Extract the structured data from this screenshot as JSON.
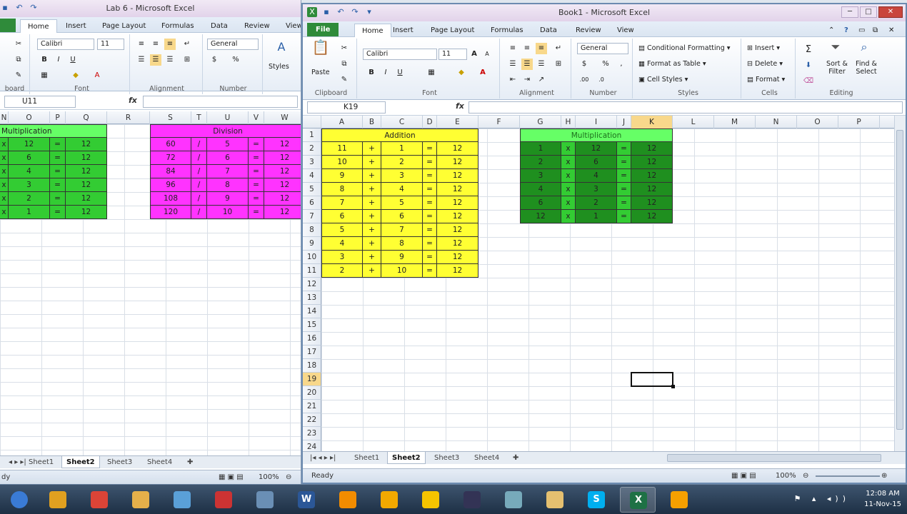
{
  "window_left": {
    "title": "Lab 6 - Microsoft Excel",
    "tabs": [
      "Home",
      "Insert",
      "Page Layout",
      "Formulas",
      "Data",
      "Review",
      "View"
    ],
    "name_box": "U11",
    "ribbon": {
      "font_name": "Calibri",
      "font_size": "11",
      "number_format": "General",
      "styles_label": "Styles",
      "groups": [
        "board",
        "Font",
        "Alignment",
        "Number"
      ]
    },
    "columns": [
      "N",
      "O",
      "P",
      "Q",
      "R",
      "S",
      "T",
      "U",
      "V",
      "W"
    ],
    "multiplication": {
      "title": "Multiplication",
      "rows": [
        [
          "x",
          "12",
          "=",
          "12"
        ],
        [
          "x",
          "6",
          "=",
          "12"
        ],
        [
          "x",
          "4",
          "=",
          "12"
        ],
        [
          "x",
          "3",
          "=",
          "12"
        ],
        [
          "x",
          "2",
          "=",
          "12"
        ],
        [
          "x",
          "1",
          "=",
          "12"
        ]
      ]
    },
    "division": {
      "title": "Division",
      "rows": [
        [
          "60",
          "/",
          "5",
          "=",
          "12"
        ],
        [
          "72",
          "/",
          "6",
          "=",
          "12"
        ],
        [
          "84",
          "/",
          "7",
          "=",
          "12"
        ],
        [
          "96",
          "/",
          "8",
          "=",
          "12"
        ],
        [
          "108",
          "/",
          "9",
          "=",
          "12"
        ],
        [
          "120",
          "/",
          "10",
          "=",
          "12"
        ]
      ]
    },
    "sheet_tabs": [
      "Sheet1",
      "Sheet2",
      "Sheet3",
      "Sheet4"
    ],
    "active_sheet": "Sheet2",
    "status": "dy",
    "zoom": "100%"
  },
  "window_right": {
    "title": "Book1 - Microsoft Excel",
    "file_tab": "File",
    "tabs": [
      "Home",
      "Insert",
      "Page Layout",
      "Formulas",
      "Data",
      "Review",
      "View"
    ],
    "name_box": "K19",
    "fx": "fx",
    "ribbon": {
      "paste": "Paste",
      "font_name": "Calibri",
      "font_size": "11",
      "number_format": "General",
      "conditional_formatting": "Conditional Formatting",
      "format_as_table": "Format as Table",
      "cell_styles": "Cell Styles",
      "insert": "Insert",
      "delete": "Delete",
      "format": "Format",
      "sort_filter": "Sort & Filter",
      "find_select": "Find & Select",
      "groups": [
        "Clipboard",
        "Font",
        "Alignment",
        "Number",
        "Styles",
        "Cells",
        "Editing"
      ]
    },
    "columns": [
      "A",
      "B",
      "C",
      "D",
      "E",
      "F",
      "G",
      "H",
      "I",
      "J",
      "K",
      "L",
      "M",
      "N",
      "O",
      "P"
    ],
    "rows": [
      "1",
      "2",
      "3",
      "4",
      "5",
      "6",
      "7",
      "8",
      "9",
      "10",
      "11",
      "12",
      "13",
      "14",
      "15",
      "16",
      "17",
      "18",
      "19",
      "20",
      "21",
      "22",
      "23",
      "24"
    ],
    "addition": {
      "title": "Addition",
      "rows": [
        [
          "11",
          "+",
          "1",
          "=",
          "12"
        ],
        [
          "10",
          "+",
          "2",
          "=",
          "12"
        ],
        [
          "9",
          "+",
          "3",
          "=",
          "12"
        ],
        [
          "8",
          "+",
          "4",
          "=",
          "12"
        ],
        [
          "7",
          "+",
          "5",
          "=",
          "12"
        ],
        [
          "6",
          "+",
          "6",
          "=",
          "12"
        ],
        [
          "5",
          "+",
          "7",
          "=",
          "12"
        ],
        [
          "4",
          "+",
          "8",
          "=",
          "12"
        ],
        [
          "3",
          "+",
          "9",
          "=",
          "12"
        ],
        [
          "2",
          "+",
          "10",
          "=",
          "12"
        ]
      ]
    },
    "multiplication": {
      "title": "Multiplication",
      "rows": [
        [
          "1",
          "x",
          "12",
          "=",
          "12"
        ],
        [
          "2",
          "x",
          "6",
          "=",
          "12"
        ],
        [
          "3",
          "x",
          "4",
          "=",
          "12"
        ],
        [
          "4",
          "x",
          "3",
          "=",
          "12"
        ],
        [
          "6",
          "x",
          "2",
          "=",
          "12"
        ],
        [
          "12",
          "x",
          "1",
          "=",
          "12"
        ]
      ]
    },
    "sheet_tabs": [
      "Sheet1",
      "Sheet2",
      "Sheet3",
      "Sheet4"
    ],
    "active_sheet": "Sheet2",
    "status": "Ready",
    "zoom": "100%"
  },
  "colors": {
    "yellow": "#ffff33",
    "green_light": "#33cc33",
    "green_bright": "#66ff66",
    "green_dark": "#1f8f1f",
    "magenta": "#ff33ff",
    "selection": "#f8d88b"
  },
  "taskbar": {
    "apps": [
      "start-orb",
      "media-player",
      "chrome",
      "file-explorer",
      "paint",
      "snipping-tool",
      "calculator",
      "word",
      "vlc",
      "other-app",
      "video-app",
      "terminal",
      "notepad",
      "folder",
      "skype",
      "excel",
      "video-editor"
    ],
    "word_glyph": "W",
    "excel_glyph": "X",
    "skype_glyph": "S",
    "time": "12:08 AM",
    "date": "11-Nov-15"
  }
}
